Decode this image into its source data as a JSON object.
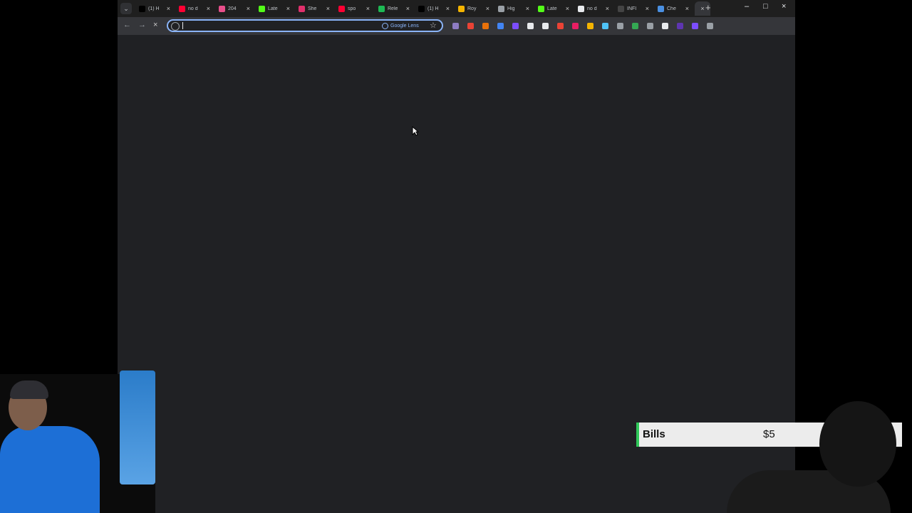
{
  "browser": {
    "tabs": [
      {
        "title": "(1) H",
        "favicon": "x-logo-icon",
        "color": "#000000",
        "active": false
      },
      {
        "title": "no d",
        "favicon": "youtube-icon",
        "color": "#ff0033",
        "active": false
      },
      {
        "title": "204",
        "favicon": "document-icon",
        "color": "#e94f8b",
        "active": false
      },
      {
        "title": "Late",
        "favicon": "kick-icon",
        "color": "#53fc18",
        "active": false
      },
      {
        "title": "She",
        "favicon": "instagram-icon",
        "color": "#e1306c",
        "active": false
      },
      {
        "title": "spo",
        "favicon": "youtube-icon",
        "color": "#ff0033",
        "active": false
      },
      {
        "title": "Rele",
        "favicon": "spotify-icon",
        "color": "#1db954",
        "active": false
      },
      {
        "title": "(1) H",
        "favicon": "x-logo-icon",
        "color": "#000000",
        "active": false
      },
      {
        "title": "Roy",
        "favicon": "triangle-icon",
        "color": "#f4b400",
        "active": false
      },
      {
        "title": "Hig",
        "favicon": "globe-icon",
        "color": "#9aa0a6",
        "active": false
      },
      {
        "title": "Late",
        "favicon": "kick-icon",
        "color": "#53fc18",
        "active": false
      },
      {
        "title": "no d",
        "favicon": "google-icon",
        "color": "#e8eaed",
        "active": false
      },
      {
        "title": "INFI",
        "favicon": "infinity-icon",
        "color": "#444444",
        "active": false
      },
      {
        "title": "Che",
        "favicon": "chatgpt-icon",
        "color": "#4a90e2",
        "active": false
      },
      {
        "title": "",
        "favicon": "",
        "color": "#35363a",
        "active": true
      }
    ],
    "omnibox": {
      "value": "",
      "lens_label": "Google Lens"
    },
    "extension_colors": [
      "#8e7cc3",
      "#ea4335",
      "#e8710a",
      "#4285f4",
      "#7c4dff",
      "#e8eaed",
      "#e8eaed",
      "#ea4335",
      "#e91e63",
      "#f4b400",
      "#4fc3f7",
      "#9aa0a6",
      "#34a853",
      "#9aa0a6",
      "#e8eaed",
      "#5e35b1",
      "#7c4dff",
      "#9aa0a6"
    ]
  },
  "overlay": {
    "ticker_label": "Bills",
    "ticker_amount": "$5",
    "ticker_accent": "#30c85a"
  },
  "symbols": {
    "tabs_menu": "⌄",
    "tab_close": "×",
    "new_tab": "+",
    "minimize": "–",
    "maximize": "□",
    "close": "×",
    "back": "←",
    "forward": "→",
    "stop": "×",
    "star": "☆"
  }
}
